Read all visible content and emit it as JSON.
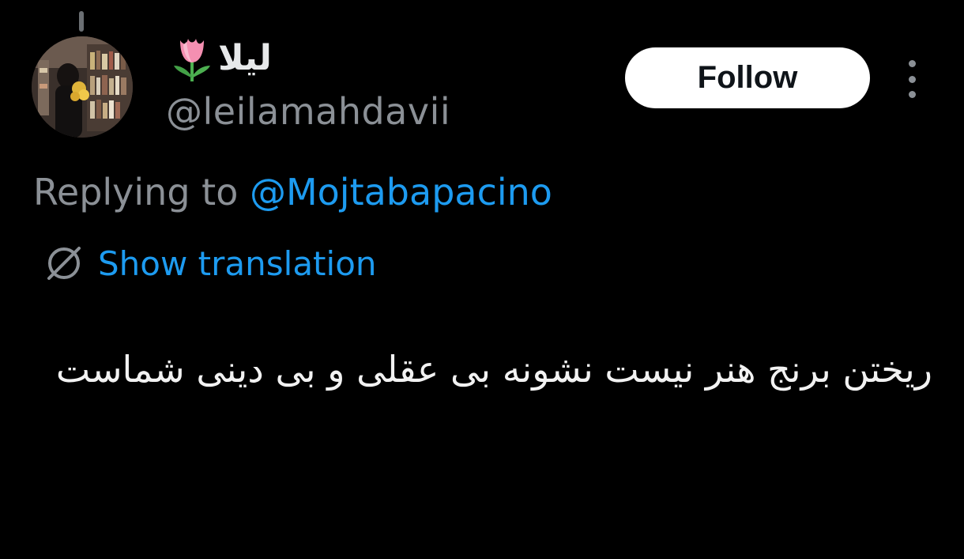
{
  "tweet": {
    "author": {
      "display_name": "ليلا",
      "handle": "@leilamahdavii",
      "name_emoji_icon": "tulip-icon"
    },
    "follow_label": "Follow",
    "reply_label": "Replying to",
    "reply_mention": "@Mojtabapacino",
    "translate_label": "Show translation",
    "body": "ریختن برنج هنر نیست نشونه بی عقلی و بی دینی شماست"
  },
  "colors": {
    "background": "#000000",
    "link": "#1d9bf0",
    "secondary_text": "#8b9096",
    "follow_button_bg": "#ffffff"
  }
}
